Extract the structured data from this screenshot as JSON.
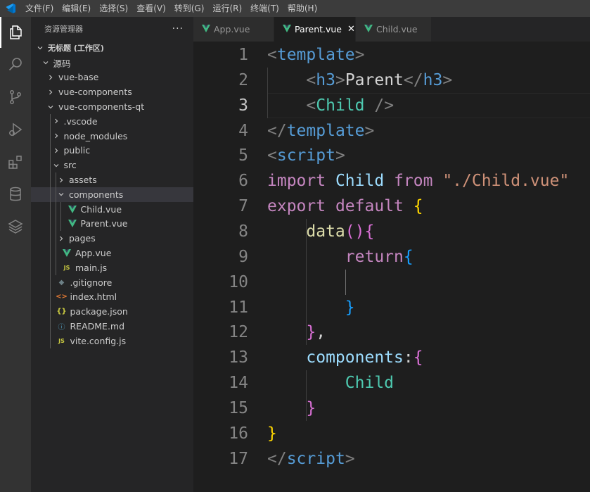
{
  "menu": [
    "文件(F)",
    "编辑(E)",
    "选择(S)",
    "查看(V)",
    "转到(G)",
    "运行(R)",
    "终端(T)",
    "帮助(H)"
  ],
  "activity_icons": [
    "explorer-icon",
    "search-icon",
    "source-control-icon",
    "run-debug-icon",
    "extensions-icon",
    "database-icon",
    "layers-icon"
  ],
  "sidebar": {
    "title": "资源管理器",
    "more": "···",
    "tree": [
      {
        "label": "无标题 (工作区)",
        "depth": 0,
        "chevron": "down",
        "icon": "",
        "bold": true,
        "selected": false
      },
      {
        "label": "源码",
        "depth": 1,
        "chevron": "down",
        "icon": "",
        "bold": false,
        "selected": false
      },
      {
        "label": "vue-base",
        "depth": 2,
        "chevron": "right",
        "icon": "",
        "bold": false,
        "selected": false
      },
      {
        "label": "vue-components",
        "depth": 2,
        "chevron": "right",
        "icon": "",
        "bold": false,
        "selected": false
      },
      {
        "label": "vue-components-qt",
        "depth": 2,
        "chevron": "down",
        "icon": "",
        "bold": false,
        "selected": false
      },
      {
        "label": ".vscode",
        "depth": 3,
        "chevron": "right",
        "icon": "",
        "bold": false,
        "selected": false
      },
      {
        "label": "node_modules",
        "depth": 3,
        "chevron": "right",
        "icon": "",
        "bold": false,
        "selected": false
      },
      {
        "label": "public",
        "depth": 3,
        "chevron": "right",
        "icon": "",
        "bold": false,
        "selected": false
      },
      {
        "label": "src",
        "depth": 3,
        "chevron": "down",
        "icon": "",
        "bold": false,
        "selected": false
      },
      {
        "label": "assets",
        "depth": 4,
        "chevron": "right",
        "icon": "",
        "bold": false,
        "selected": false
      },
      {
        "label": "components",
        "depth": 4,
        "chevron": "down",
        "icon": "",
        "bold": false,
        "selected": true
      },
      {
        "label": "Child.vue",
        "depth": 5,
        "chevron": "",
        "icon": "vue",
        "bold": false,
        "selected": false
      },
      {
        "label": "Parent.vue",
        "depth": 5,
        "chevron": "",
        "icon": "vue",
        "bold": false,
        "selected": false
      },
      {
        "label": "pages",
        "depth": 4,
        "chevron": "right",
        "icon": "",
        "bold": false,
        "selected": false
      },
      {
        "label": "App.vue",
        "depth": 4,
        "chevron": "",
        "icon": "vue",
        "bold": false,
        "selected": false
      },
      {
        "label": "main.js",
        "depth": 4,
        "chevron": "",
        "icon": "js",
        "bold": false,
        "selected": false
      },
      {
        "label": ".gitignore",
        "depth": 3,
        "chevron": "",
        "icon": "git",
        "bold": false,
        "selected": false
      },
      {
        "label": "index.html",
        "depth": 3,
        "chevron": "",
        "icon": "html",
        "bold": false,
        "selected": false
      },
      {
        "label": "package.json",
        "depth": 3,
        "chevron": "",
        "icon": "json",
        "bold": false,
        "selected": false
      },
      {
        "label": "README.md",
        "depth": 3,
        "chevron": "",
        "icon": "info",
        "bold": false,
        "selected": false
      },
      {
        "label": "vite.config.js",
        "depth": 3,
        "chevron": "",
        "icon": "js",
        "bold": false,
        "selected": false
      }
    ]
  },
  "tabs": [
    {
      "label": "App.vue",
      "active": false,
      "close": ""
    },
    {
      "label": "Parent.vue",
      "active": true,
      "close": "✕"
    },
    {
      "label": "Child.vue",
      "active": false,
      "close": ""
    }
  ],
  "editor": {
    "current_line": 3,
    "lines": [
      [
        [
          "pu",
          "<"
        ],
        [
          "tg",
          "template"
        ],
        [
          "pu",
          ">"
        ]
      ],
      [
        [
          "tx",
          "    "
        ],
        [
          "pu",
          "<"
        ],
        [
          "tg",
          "h3"
        ],
        [
          "pu",
          ">"
        ],
        [
          "tx",
          "Parent"
        ],
        [
          "pu",
          "</"
        ],
        [
          "tg",
          "h3"
        ],
        [
          "pu",
          ">"
        ]
      ],
      [
        [
          "tx",
          "    "
        ],
        [
          "pu",
          "<"
        ],
        [
          "cm",
          "Child"
        ],
        [
          "tx",
          " "
        ],
        [
          "pu",
          "/>"
        ]
      ],
      [
        [
          "pu",
          "</"
        ],
        [
          "tg",
          "template"
        ],
        [
          "pu",
          ">"
        ]
      ],
      [
        [
          "pu",
          "<"
        ],
        [
          "tg",
          "script"
        ],
        [
          "pu",
          ">"
        ]
      ],
      [
        [
          "kw",
          "import"
        ],
        [
          "tx",
          " "
        ],
        [
          "vr",
          "Child"
        ],
        [
          "tx",
          " "
        ],
        [
          "kw",
          "from"
        ],
        [
          "tx",
          " "
        ],
        [
          "st",
          "\"./Child.vue\""
        ]
      ],
      [
        [
          "kw",
          "export"
        ],
        [
          "tx",
          " "
        ],
        [
          "kw",
          "default"
        ],
        [
          "tx",
          " "
        ],
        [
          "b1",
          "{"
        ]
      ],
      [
        [
          "tx",
          "    "
        ],
        [
          "fn",
          "data"
        ],
        [
          "b2",
          "()"
        ],
        [
          "b2",
          "{"
        ]
      ],
      [
        [
          "tx",
          "        "
        ],
        [
          "kw",
          "return"
        ],
        [
          "b3",
          "{"
        ]
      ],
      [],
      [
        [
          "tx",
          "        "
        ],
        [
          "b3",
          "}"
        ]
      ],
      [
        [
          "tx",
          "    "
        ],
        [
          "b2",
          "}"
        ],
        [
          "tx",
          ","
        ]
      ],
      [
        [
          "tx",
          "    "
        ],
        [
          "vr",
          "components"
        ],
        [
          "tx",
          ":"
        ],
        [
          "b2",
          "{"
        ]
      ],
      [
        [
          "tx",
          "        "
        ],
        [
          "cm",
          "Child"
        ]
      ],
      [
        [
          "tx",
          "    "
        ],
        [
          "b2",
          "}"
        ]
      ],
      [
        [
          "b1",
          "}"
        ]
      ],
      [
        [
          "pu",
          "</"
        ],
        [
          "tg",
          "script"
        ],
        [
          "pu",
          ">"
        ]
      ]
    ]
  }
}
